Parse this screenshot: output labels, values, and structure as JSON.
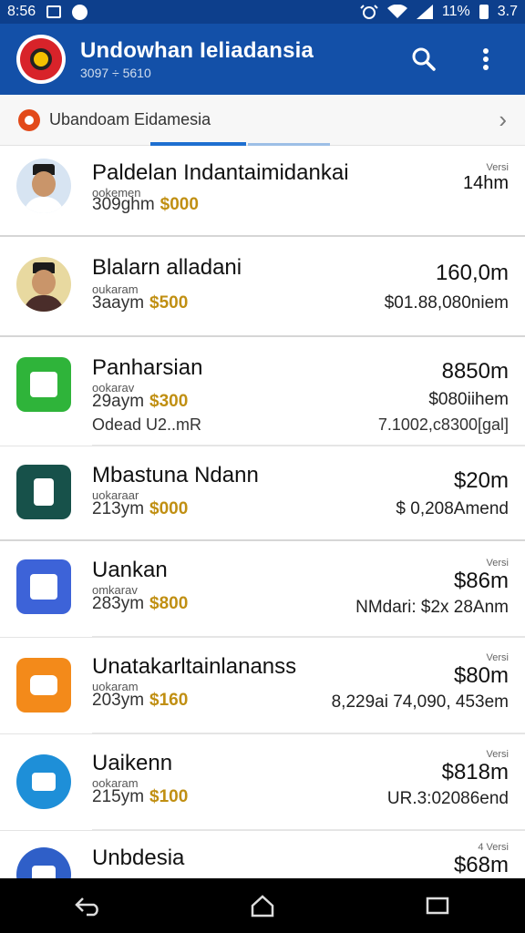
{
  "status_bar": {
    "time": "8:56",
    "battery": "11%",
    "network": "3.7"
  },
  "app": {
    "title": "Undowhan Ieliadansia",
    "subtitle": "3097 ÷ 5610"
  },
  "breadcrumb": {
    "label": "Ubandoam Eidamesia"
  },
  "colors": {
    "app_bar": "#1350a8",
    "status_bar": "#0d3f8c",
    "price": "#c08f12",
    "tab_indicator": "#1e6fd0"
  },
  "items": [
    {
      "title": "Paldelan Indantaimidankai",
      "sub": "ookemen",
      "meta": "309ghm",
      "price": "$000",
      "tag": "Versi",
      "right": "14hm",
      "icon": "person-avatar"
    },
    {
      "title": "Blalarn alladani",
      "sub": "oukaram",
      "meta": "3aaym",
      "price": "$500",
      "right": "160,0m",
      "right2": "$01.88,080niem",
      "icon": "person-avatar"
    },
    {
      "title": "Panharsian",
      "sub": "ookarav",
      "meta": "29aym",
      "price": "$300",
      "extra": "Odead U2..mR",
      "right": "8850m",
      "right2": "$080iihem",
      "right3": "7.1002,c8300[gal]",
      "icon": "message-icon",
      "color": "#2fb43a"
    },
    {
      "title": "Mbastuna Ndann",
      "sub": "uokaraar",
      "meta": "213ym",
      "price": "$000",
      "right": "$20m",
      "right2": "$ 0,208Amend",
      "icon": "document-icon",
      "color": "#17514a"
    },
    {
      "title": "Uankan",
      "sub": "omkarav",
      "meta": "283ym",
      "price": "$800",
      "tag": "Versi",
      "right": "$86m",
      "right2": "NMdari: $2x 28Anm",
      "icon": "folder-icon",
      "color": "#3d63d8"
    },
    {
      "title": "Unatakarltainlananss",
      "sub": "uokaram",
      "meta": "203ym",
      "price": "$160",
      "tag": "Versi",
      "right": "$80m",
      "right2": "8,229ai 74,090, 453em",
      "icon": "camera-icon",
      "color": "#f38a1a"
    },
    {
      "title": "Uaikenn",
      "sub": "ookaram",
      "meta": "215ym",
      "price": "$100",
      "tag": "Versi",
      "right": "$818m",
      "right2": "UR.3:02086end",
      "icon": "mail-icon",
      "color": "#1e8fd8"
    },
    {
      "title": "Unbdesia",
      "tag": "4 Versi",
      "right": "$68m",
      "icon": "mail-icon",
      "color": "#2f5fc8"
    }
  ],
  "nav": {
    "back": "back-icon",
    "home": "home-icon",
    "recents": "recents-icon"
  }
}
